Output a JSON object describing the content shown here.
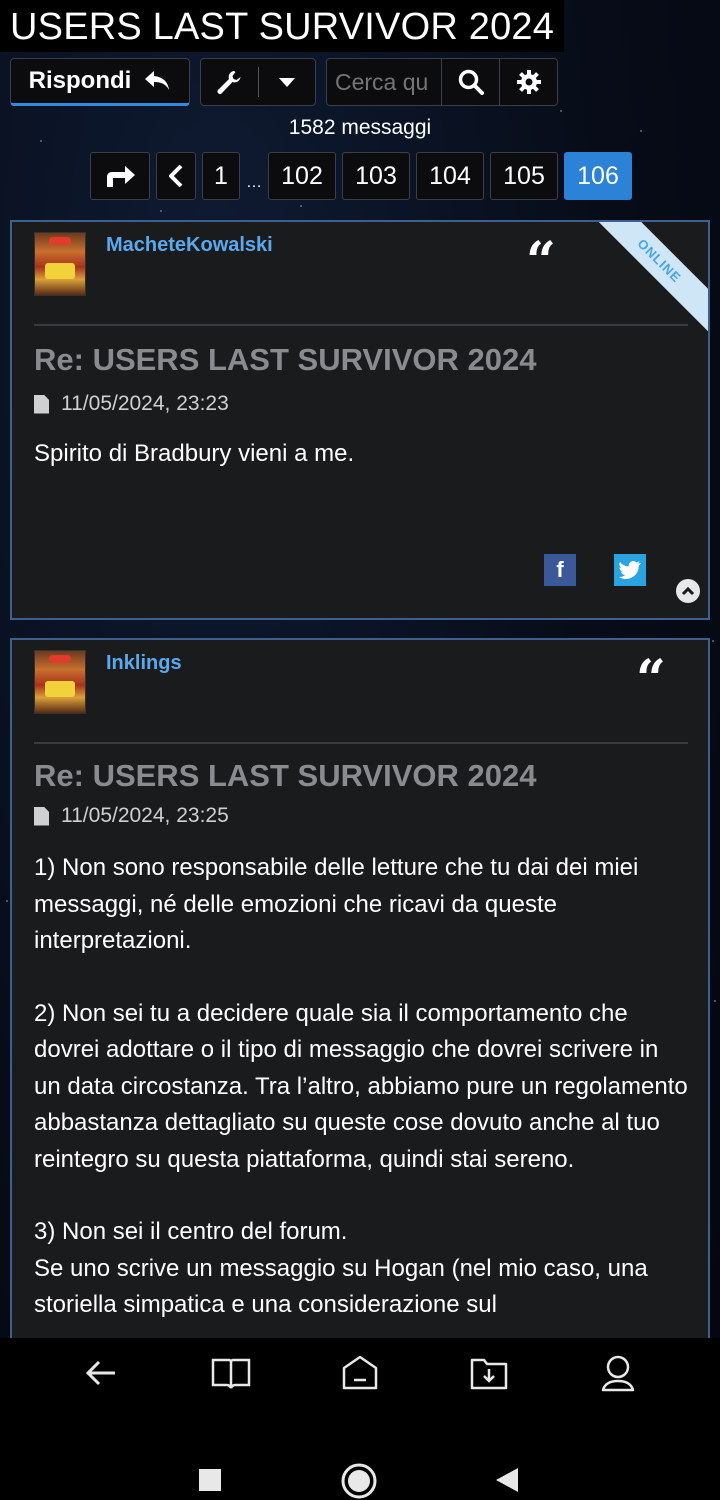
{
  "header": {
    "title": "USERS LAST SURVIVOR 2024"
  },
  "toolbar": {
    "reply_label": "Rispondi",
    "search_placeholder": "Cerca qu",
    "reply_icon": "reply-icon",
    "tools_icon": "wrench-icon",
    "dropdown_icon": "caret-down-icon",
    "search_icon": "search-icon",
    "settings_icon": "gear-icon"
  },
  "topic": {
    "message_count": "1582 messaggi"
  },
  "pagination": {
    "first": "1",
    "ellipsis": "…",
    "pages": [
      "102",
      "103",
      "104",
      "105"
    ],
    "current": "106"
  },
  "posts": [
    {
      "author": "MacheteKowalski",
      "badge": "ONLINE",
      "title": "Re: USERS LAST SURVIVOR 2024",
      "timestamp": "11/05/2024, 23:23",
      "body": [
        "Spirito di Bradbury vieni a me."
      ]
    },
    {
      "author": "Inklings",
      "title": "Re: USERS LAST SURVIVOR 2024",
      "timestamp": "11/05/2024, 23:25",
      "body": [
        "1) Non sono responsabile delle letture che tu dai dei miei messaggi, né delle emozioni che ricavi da queste interpretazioni.",
        "2) Non sei tu a decidere quale sia il comportamento che dovrei adottare o il tipo di messaggio che dovrei scrivere in un data circostanza. Tra l’altro, abbiamo pure un regolamento abbastanza dettagliato su queste cose dovuto anche al tuo reintegro su questa piattaforma, quindi stai sereno.",
        "3) Non sei il centro del forum.",
        "Se uno scrive un messaggio su Hogan (nel mio caso, una storiella simpatica e una considerazione sul"
      ]
    }
  ],
  "colors": {
    "accent": "#2b82d6",
    "link": "#5aa9ef",
    "post_border": "#3f5f8e"
  }
}
